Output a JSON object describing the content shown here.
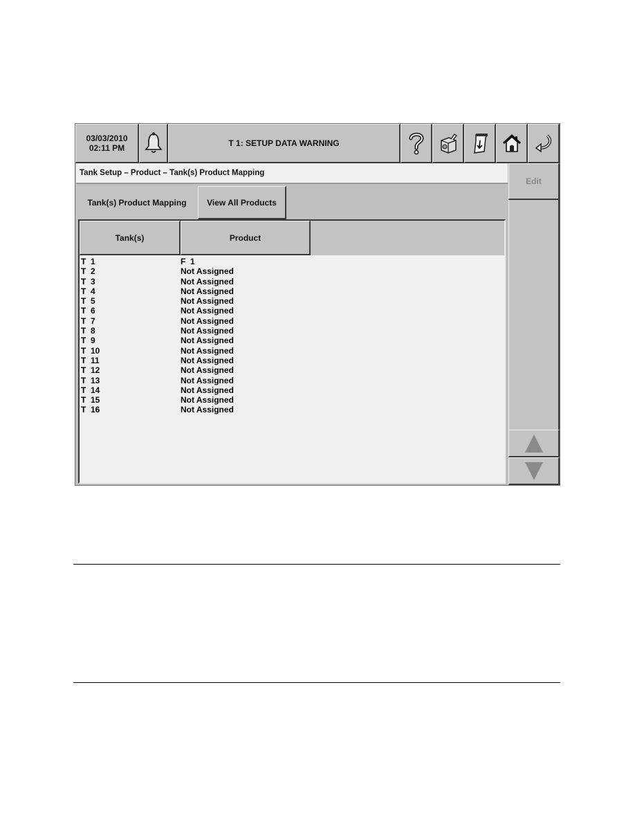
{
  "topbar": {
    "date": "03/03/2010",
    "time": "02:11 PM",
    "alarm_icon": "bell-icon",
    "alarm_message": "T 1: SETUP DATA WARNING",
    "buttons": [
      {
        "name": "help",
        "icon": "question-mark-icon"
      },
      {
        "name": "diagnostics",
        "icon": "gears-box-icon"
      },
      {
        "name": "print",
        "icon": "printer-receipt-icon"
      },
      {
        "name": "home",
        "icon": "home-icon"
      },
      {
        "name": "back",
        "icon": "back-arrow-icon"
      }
    ]
  },
  "breadcrumb": "Tank Setup  –  Product  –  Tank(s) Product Mapping",
  "side": {
    "edit_label": "Edit",
    "scroll_up_icon": "triangle-up-icon",
    "scroll_down_icon": "triangle-down-icon"
  },
  "tabs": [
    {
      "label": "Tank(s) Product Mapping",
      "active": true
    },
    {
      "label": "View All Products",
      "active": false
    }
  ],
  "table": {
    "columns": [
      "Tank(s)",
      "Product"
    ],
    "rows": [
      [
        "T  1",
        "F  1"
      ],
      [
        "T  2",
        "Not Assigned"
      ],
      [
        "T  3",
        "Not Assigned"
      ],
      [
        "T  4",
        "Not Assigned"
      ],
      [
        "T  5",
        "Not Assigned"
      ],
      [
        "T  6",
        "Not Assigned"
      ],
      [
        "T  7",
        "Not Assigned"
      ],
      [
        "T  8",
        "Not Assigned"
      ],
      [
        "T  9",
        "Not Assigned"
      ],
      [
        "T  10",
        "Not Assigned"
      ],
      [
        "T  11",
        "Not Assigned"
      ],
      [
        "T  12",
        "Not Assigned"
      ],
      [
        "T  13",
        "Not Assigned"
      ],
      [
        "T  14",
        "Not Assigned"
      ],
      [
        "T  15",
        "Not Assigned"
      ],
      [
        "T  16",
        "Not Assigned"
      ]
    ]
  }
}
